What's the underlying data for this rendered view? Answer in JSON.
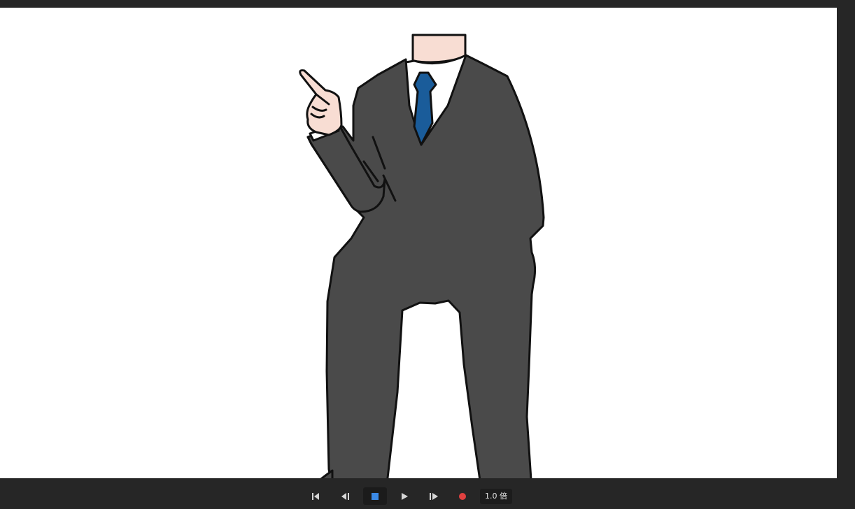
{
  "player": {
    "controls": {
      "first_frame_icon": "skip-to-start-icon",
      "prev_frame_icon": "step-back-icon",
      "stop_icon": "stop-icon",
      "play_icon": "play-icon",
      "next_frame_icon": "step-forward-icon",
      "record_icon": "record-icon",
      "speed_label": "1.0 倍"
    },
    "colors": {
      "background": "#262626",
      "canvas": "#ffffff",
      "stop_accent": "#3b8ae6",
      "record_accent": "#e0403f",
      "suit": "#4a4a4a",
      "tie": "#1a5c9a",
      "skin": "#f8ddd3",
      "outline": "#111111"
    }
  }
}
